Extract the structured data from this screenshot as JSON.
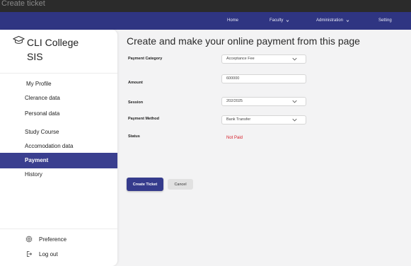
{
  "window": {
    "title": "Create ticket"
  },
  "topnav": {
    "items": [
      {
        "label": "Home",
        "dropdown": false
      },
      {
        "label": "Faculty",
        "dropdown": true
      },
      {
        "label": "Administration",
        "dropdown": true
      },
      {
        "label": "Setting",
        "dropdown": false
      }
    ]
  },
  "sidebar": {
    "brand_line1": "CLI College",
    "brand_line2": "SIS",
    "items": [
      {
        "label": "My Profile"
      },
      {
        "label": "Clerance data"
      },
      {
        "label": "Personal data"
      },
      {
        "label": "Study Course"
      },
      {
        "label": "Accomodation data"
      },
      {
        "label": "Payment",
        "active": true
      },
      {
        "label": "History"
      }
    ],
    "footer": {
      "preference": "Preference",
      "logout": "Log out"
    }
  },
  "main": {
    "title": "Create and make your online payment from this page",
    "form": {
      "payment_category": {
        "label": "Payment Category",
        "value": "Acceptance Fee"
      },
      "amount": {
        "label": "Amount",
        "value": "600000"
      },
      "session": {
        "label": "Session",
        "value": "202/2025"
      },
      "payment_method": {
        "label": "Payment Method",
        "value": "Bank Transfer"
      },
      "status": {
        "label": "Status",
        "value": "Not Paid"
      }
    },
    "buttons": {
      "create": "Create Ticket",
      "cancel": "Cancel"
    }
  },
  "colors": {
    "nav_bg": "#2f3582",
    "active_item": "#3a3f8f",
    "primary_button": "#353b8c",
    "status_unpaid": "#d61f2a"
  }
}
